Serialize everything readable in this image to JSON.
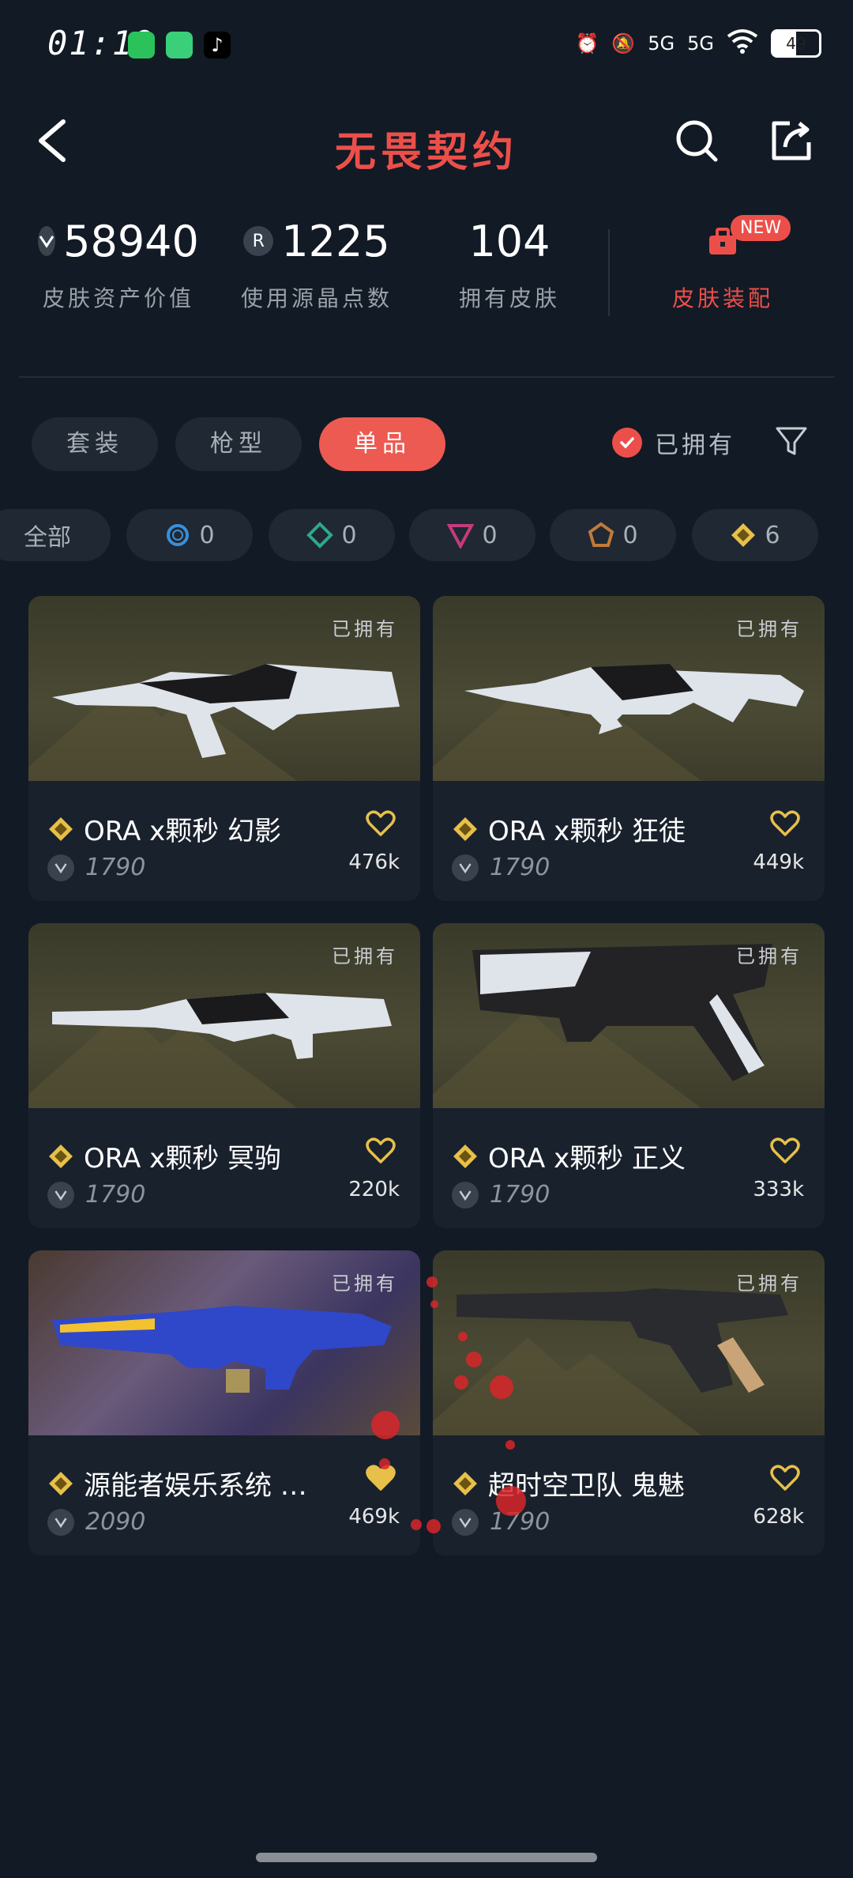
{
  "status_bar": {
    "time": "01:19",
    "network1": "5G",
    "network2": "5G",
    "battery": "49"
  },
  "header": {
    "title": "无畏契约"
  },
  "stats": [
    {
      "value": "58940",
      "label": "皮肤资产价值"
    },
    {
      "value": "1225",
      "label": "使用源晶点数"
    },
    {
      "value": "104",
      "label": "拥有皮肤"
    }
  ],
  "skin_equip": {
    "label": "皮肤装配",
    "badge": "NEW"
  },
  "tabs": [
    {
      "label": "套装"
    },
    {
      "label": "枪型"
    },
    {
      "label": "单品"
    }
  ],
  "owned_filter": {
    "label": "已拥有"
  },
  "tiers": [
    {
      "label": "全部"
    },
    {
      "count": "0"
    },
    {
      "count": "0"
    },
    {
      "count": "0"
    },
    {
      "count": "0"
    },
    {
      "count": "6"
    }
  ],
  "items": [
    {
      "name": "ORA x颗秒 幻影",
      "price": "1790",
      "likes": "476k",
      "owned": "已拥有"
    },
    {
      "name": "ORA x颗秒 狂徒",
      "price": "1790",
      "likes": "449k",
      "owned": "已拥有"
    },
    {
      "name": "ORA x颗秒 冥驹",
      "price": "1790",
      "likes": "220k",
      "owned": "已拥有"
    },
    {
      "name": "ORA x颗秒 正义",
      "price": "1790",
      "likes": "333k",
      "owned": "已拥有"
    },
    {
      "name": "源能者娱乐系统 …",
      "price": "2090",
      "likes": "469k",
      "owned": "已拥有"
    },
    {
      "name": "超时空卫队 鬼魅",
      "price": "1790",
      "likes": "628k",
      "owned": "已拥有"
    }
  ],
  "colors": {
    "accent": "#ec4f4a",
    "background": "#121a25",
    "card": "#19212d",
    "gold": "#e7c04a"
  }
}
